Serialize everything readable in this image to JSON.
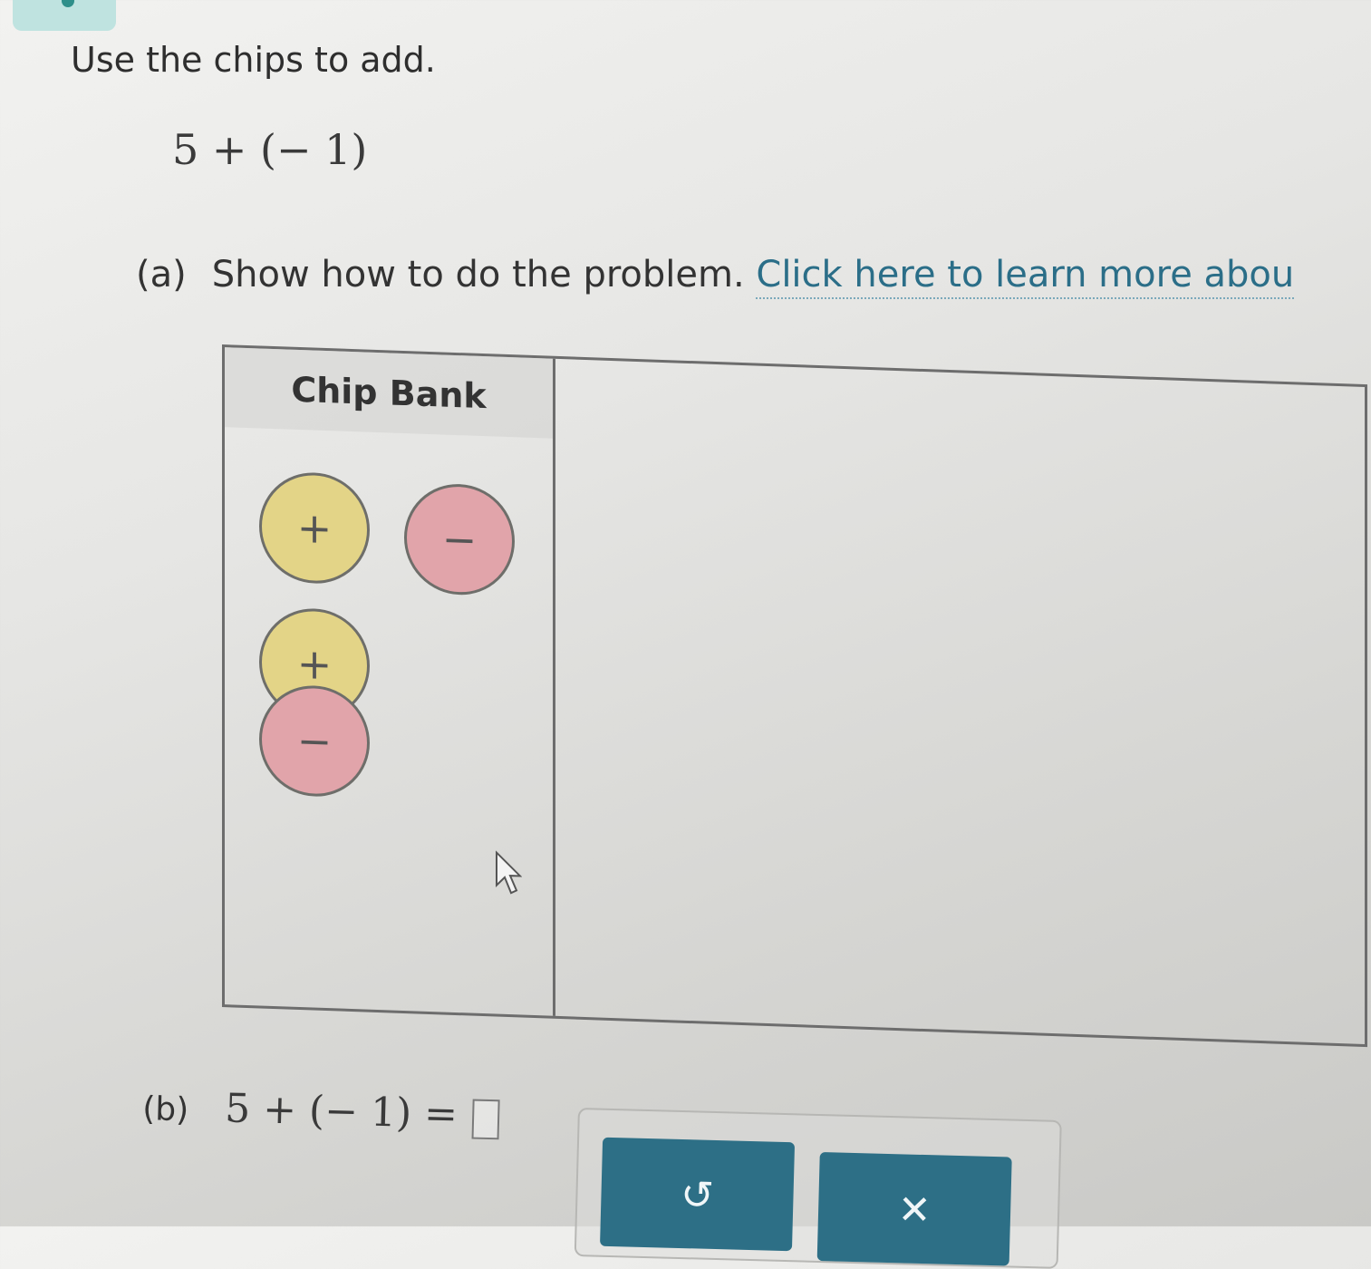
{
  "instruction": "Use the chips to add.",
  "expression": "5 + (− 1)",
  "part_a": {
    "label": "(a)",
    "text": "Show how to do the problem.",
    "link_text": "Click here to learn more abou"
  },
  "chip_bank": {
    "title": "Chip Bank",
    "chips": [
      {
        "sign": "+",
        "type": "positive"
      },
      {
        "sign": "−",
        "type": "negative"
      },
      {
        "sign": "+",
        "type": "positive"
      },
      {
        "sign": "−",
        "type": "negative"
      }
    ]
  },
  "part_b": {
    "label": "(b)",
    "equation": "5 + (− 1) ="
  },
  "actions": {
    "undo_symbol": "↺",
    "clear_symbol": "✕"
  },
  "colors": {
    "positive_chip": "#e3d487",
    "negative_chip": "#e1a4aa",
    "link": "#2b6e88",
    "button": "#2d6f86"
  }
}
